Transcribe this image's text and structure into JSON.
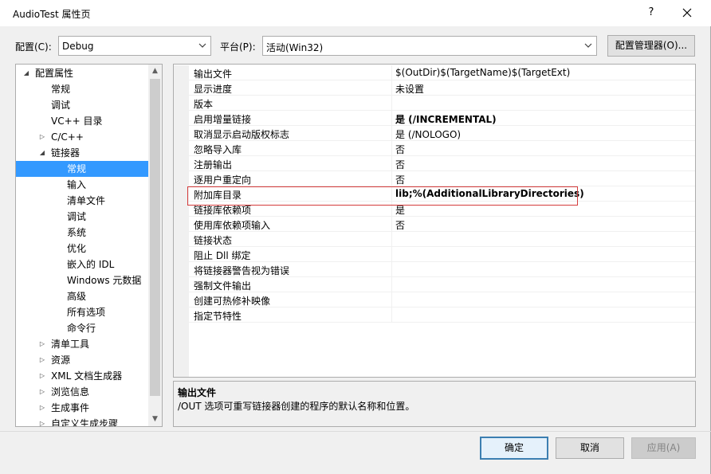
{
  "window": {
    "title": "AudioTest 属性页",
    "help_glyph": "?",
    "close_glyph": "✕"
  },
  "config": {
    "config_label": "配置(C):",
    "config_value": "Debug",
    "platform_label": "平台(P):",
    "platform_value": "活动(Win32)",
    "manager_button": "配置管理器(O)..."
  },
  "tree": {
    "items": [
      {
        "label": "配置属性",
        "level": 0,
        "expander": "◢",
        "selected": false
      },
      {
        "label": "常规",
        "level": 1,
        "expander": "",
        "selected": false
      },
      {
        "label": "调试",
        "level": 1,
        "expander": "",
        "selected": false
      },
      {
        "label": "VC++ 目录",
        "level": 1,
        "expander": "",
        "selected": false
      },
      {
        "label": "C/C++",
        "level": 1,
        "expander": "▷",
        "selected": false
      },
      {
        "label": "链接器",
        "level": 1,
        "expander": "◢",
        "selected": false
      },
      {
        "label": "常规",
        "level": 2,
        "expander": "",
        "selected": true
      },
      {
        "label": "输入",
        "level": 2,
        "expander": "",
        "selected": false
      },
      {
        "label": "清单文件",
        "level": 2,
        "expander": "",
        "selected": false
      },
      {
        "label": "调试",
        "level": 2,
        "expander": "",
        "selected": false
      },
      {
        "label": "系统",
        "level": 2,
        "expander": "",
        "selected": false
      },
      {
        "label": "优化",
        "level": 2,
        "expander": "",
        "selected": false
      },
      {
        "label": "嵌入的 IDL",
        "level": 2,
        "expander": "",
        "selected": false
      },
      {
        "label": "Windows 元数据",
        "level": 2,
        "expander": "",
        "selected": false
      },
      {
        "label": "高级",
        "level": 2,
        "expander": "",
        "selected": false
      },
      {
        "label": "所有选项",
        "level": 2,
        "expander": "",
        "selected": false
      },
      {
        "label": "命令行",
        "level": 2,
        "expander": "",
        "selected": false
      },
      {
        "label": "清单工具",
        "level": 1,
        "expander": "▷",
        "selected": false
      },
      {
        "label": "资源",
        "level": 1,
        "expander": "▷",
        "selected": false
      },
      {
        "label": "XML 文档生成器",
        "level": 1,
        "expander": "▷",
        "selected": false
      },
      {
        "label": "浏览信息",
        "level": 1,
        "expander": "▷",
        "selected": false
      },
      {
        "label": "生成事件",
        "level": 1,
        "expander": "▷",
        "selected": false
      },
      {
        "label": "自定义生成步骤",
        "level": 1,
        "expander": "▷",
        "selected": false
      }
    ],
    "scroll_up": "▲",
    "scroll_down": "▼"
  },
  "properties": {
    "rows": [
      {
        "name": "输出文件",
        "value": "$(OutDir)$(TargetName)$(TargetExt)",
        "bold": false
      },
      {
        "name": "显示进度",
        "value": "未设置",
        "bold": false
      },
      {
        "name": "版本",
        "value": "",
        "bold": false
      },
      {
        "name": "启用增量链接",
        "value": "是 (/INCREMENTAL)",
        "bold": true
      },
      {
        "name": "取消显示启动版权标志",
        "value": "是 (/NOLOGO)",
        "bold": false
      },
      {
        "name": "忽略导入库",
        "value": "否",
        "bold": false
      },
      {
        "name": "注册输出",
        "value": "否",
        "bold": false
      },
      {
        "name": "逐用户重定向",
        "value": "否",
        "bold": false
      },
      {
        "name": "附加库目录",
        "value": "lib;%(AdditionalLibraryDirectories)",
        "bold": true
      },
      {
        "name": "链接库依赖项",
        "value": "是",
        "bold": false
      },
      {
        "name": "使用库依赖项输入",
        "value": "否",
        "bold": false
      },
      {
        "name": "链接状态",
        "value": "",
        "bold": false
      },
      {
        "name": "阻止 Dll 绑定",
        "value": "",
        "bold": false
      },
      {
        "name": "将链接器警告视为错误",
        "value": "",
        "bold": false
      },
      {
        "name": "强制文件输出",
        "value": "",
        "bold": false
      },
      {
        "name": "创建可热修补映像",
        "value": "",
        "bold": false
      },
      {
        "name": "指定节特性",
        "value": "",
        "bold": false
      }
    ]
  },
  "description": {
    "title": "输出文件",
    "text": "/OUT 选项可重写链接器创建的程序的默认名称和位置。"
  },
  "buttons": {
    "ok": "确定",
    "cancel": "取消",
    "apply": "应用(A)"
  },
  "colors": {
    "selection": "#3399ff",
    "highlight_border": "#d43c3c",
    "default_button_border": "#3c7fb1"
  }
}
